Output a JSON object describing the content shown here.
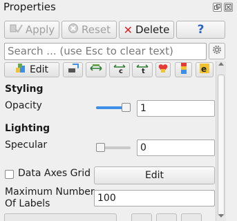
{
  "panel_title": "Properties",
  "buttons": {
    "apply": "Apply",
    "reset": "Reset",
    "delete": "Delete",
    "help": "?"
  },
  "search": {
    "placeholder": "Search ... (use Esc to clear text)"
  },
  "toolbar": {
    "edit_label": "Edit"
  },
  "styling": {
    "heading": "Styling",
    "opacity_label": "Opacity",
    "opacity_value": "1",
    "opacity_fraction": 1.0
  },
  "lighting": {
    "heading": "Lighting",
    "specular_label": "Specular",
    "specular_value": "0",
    "specular_fraction": 0.0
  },
  "axes_grid": {
    "label": "Data Axes Grid",
    "checked": false,
    "edit_label": "Edit"
  },
  "max_labels": {
    "label_line1": "Maximum Number",
    "label_line2": "Of Labels",
    "value": "100"
  },
  "colors": {
    "accent": "#3d8ee6",
    "delete_red": "#d8262a",
    "help_blue": "#2b66c6"
  }
}
